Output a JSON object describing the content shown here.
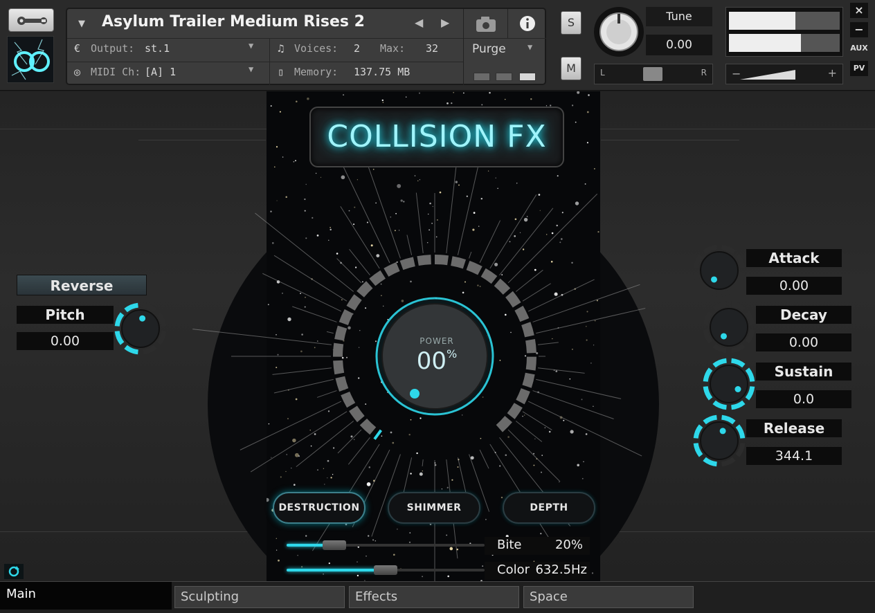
{
  "header": {
    "instrument_name": "Asylum Trailer Medium Rises 2",
    "output_label": "Output:",
    "output_value": "st.1",
    "midi_label": "MIDI Ch:",
    "midi_value": "[A] 1",
    "voices_label": "Voices:",
    "voices_value": "2",
    "max_label": "Max:",
    "max_value": "32",
    "memory_label": "Memory:",
    "memory_value": "137.75 MB",
    "purge_label": "Purge",
    "solo_label": "S",
    "mute_label": "M",
    "tune_label": "Tune",
    "tune_value": "0.00",
    "pan_left": "L",
    "pan_right": "R",
    "vol_minus": "−",
    "vol_plus": "+",
    "close_label": "×",
    "minimize_label": "−",
    "aux_label": "AUX",
    "pv_label": "PV"
  },
  "plugin": {
    "title": "COLLISION FX",
    "power_label": "POWER",
    "power_value": "00",
    "power_unit": "%",
    "reverse_label": "Reverse",
    "pitch_label": "Pitch",
    "pitch_value": "0.00",
    "modes": [
      {
        "label": "DESTRUCTION",
        "active": true
      },
      {
        "label": "SHIMMER",
        "active": false
      },
      {
        "label": "DEPTH",
        "active": false
      }
    ],
    "envelope": [
      {
        "label": "Attack",
        "value": "0.00"
      },
      {
        "label": "Decay",
        "value": "0.00"
      },
      {
        "label": "Sustain",
        "value": "0.0"
      },
      {
        "label": "Release",
        "value": "344.1"
      }
    ],
    "bite_label": "Bite",
    "bite_value": "20%",
    "color_label": "Color",
    "color_value": "632.5Hz"
  },
  "tabs": [
    {
      "label": "Main",
      "active": true
    },
    {
      "label": "Sculpting",
      "active": false
    },
    {
      "label": "Effects",
      "active": false
    },
    {
      "label": "Space",
      "active": false
    }
  ],
  "colors": {
    "accent": "#2ed8ea",
    "panel": "#3c3c3c",
    "background": "#242424"
  }
}
